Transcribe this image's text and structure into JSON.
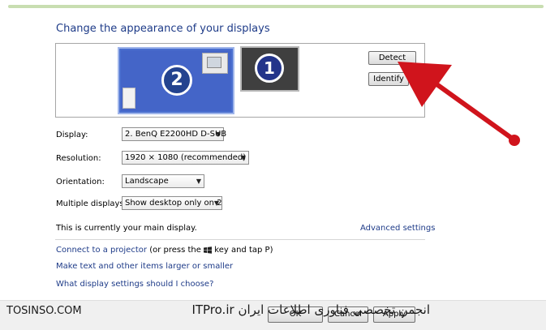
{
  "window": {
    "title": "Change the appearance of your displays"
  },
  "preview": {
    "monitor_2_number": "2",
    "monitor_1_number": "1",
    "detect_label": "Detect",
    "identify_label": "Identify"
  },
  "settings": {
    "display": {
      "label": "Display:",
      "value": "2. BenQ E2200HD D-SUB"
    },
    "resolution": {
      "label": "Resolution:",
      "value": "1920 × 1080 (recommended)"
    },
    "orientation": {
      "label": "Orientation:",
      "value": "Landscape"
    },
    "multiple": {
      "label": "Multiple displays:",
      "value": "Show desktop only on 2"
    }
  },
  "main_display_text": "This is currently your main display.",
  "advanced_link": "Advanced settings",
  "links": {
    "projector_link": "Connect to a projector",
    "projector_suffix_a": "(or press the",
    "projector_suffix_b": "key and tap P)",
    "text_size_link": "Make text and other items larger or smaller",
    "help_link": "What display settings should I choose?"
  },
  "footer": {
    "ok_label": "OK",
    "cancel_label": "Cancel",
    "apply_label": "Apply"
  },
  "watermark": {
    "left": "TOSINSO.COM",
    "right": "انجمن تخصصی فناوری اطلاعات ایران  ITPro.ir"
  },
  "colors": {
    "accent_link": "#1e3b88",
    "selected_monitor": "#4a6fd0",
    "annotation_arrow": "#d0141c"
  }
}
